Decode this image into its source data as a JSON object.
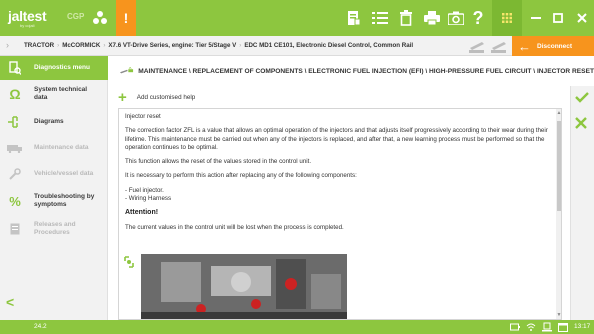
{
  "app": {
    "logo_text": "jaltest",
    "logo_sub": "by cojali",
    "product_label": "CGP",
    "version": "24.2",
    "time": "13:17"
  },
  "breadcrumb": {
    "items": [
      "TRACTOR",
      "McCORMICK",
      "X7.6 VT-Drive Series, engine: Tier 5/Stage V",
      "EDC MD1 CE101, Electronic Diesel Control, Common Rail"
    ],
    "disconnect_label": "Disconnect"
  },
  "sidebar": {
    "items": [
      {
        "label": "Diagnostics menu",
        "icon": "diagnostics-icon",
        "state": "active"
      },
      {
        "label": "System technical data",
        "icon": "ohm-icon",
        "state": "enabled"
      },
      {
        "label": "Diagrams",
        "icon": "diagram-icon",
        "state": "enabled"
      },
      {
        "label": "Maintenance data",
        "icon": "maintenance-icon",
        "state": "disabled"
      },
      {
        "label": "Vehicle/vessel data",
        "icon": "wrench-icon",
        "state": "disabled"
      },
      {
        "label": "Troubleshooting by symptoms",
        "icon": "percent-icon",
        "state": "enabled"
      },
      {
        "label": "Releases and Procedures",
        "icon": "document-icon",
        "state": "disabled"
      }
    ],
    "back_label": "<"
  },
  "header": {
    "path": "MAINTENANCE \\ REPLACEMENT OF COMPONENTS \\ ELECTRONIC FUEL INJECTION (EFI) \\ HIGH-PRESSURE FUEL CIRCUIT \\ INJECTOR RESET"
  },
  "help": {
    "add_label": "Add customised help"
  },
  "document": {
    "title": "Injector reset",
    "p1": "The correction factor ZFL is a value that allows an optimal operation of the injectors and that adjusts itself progressively according to their wear during their lifetime. This maintenance must be carried out when any of the injectors is replaced, and after that, a new learning process must be performed so that the operation continues to be optimal.",
    "p2": "This function allows the reset of the values stored in the control unit.",
    "p3": "It is necessary to perform this action after replacing any of the following components:",
    "list": [
      "- Fuel injector.",
      "- Wiring Harness"
    ],
    "attention": "Attention!",
    "p4": "The current values in the control unit will be lost when the process is completed."
  },
  "colors": {
    "brand_green": "#8dc63f",
    "accent_orange": "#f7941d"
  }
}
